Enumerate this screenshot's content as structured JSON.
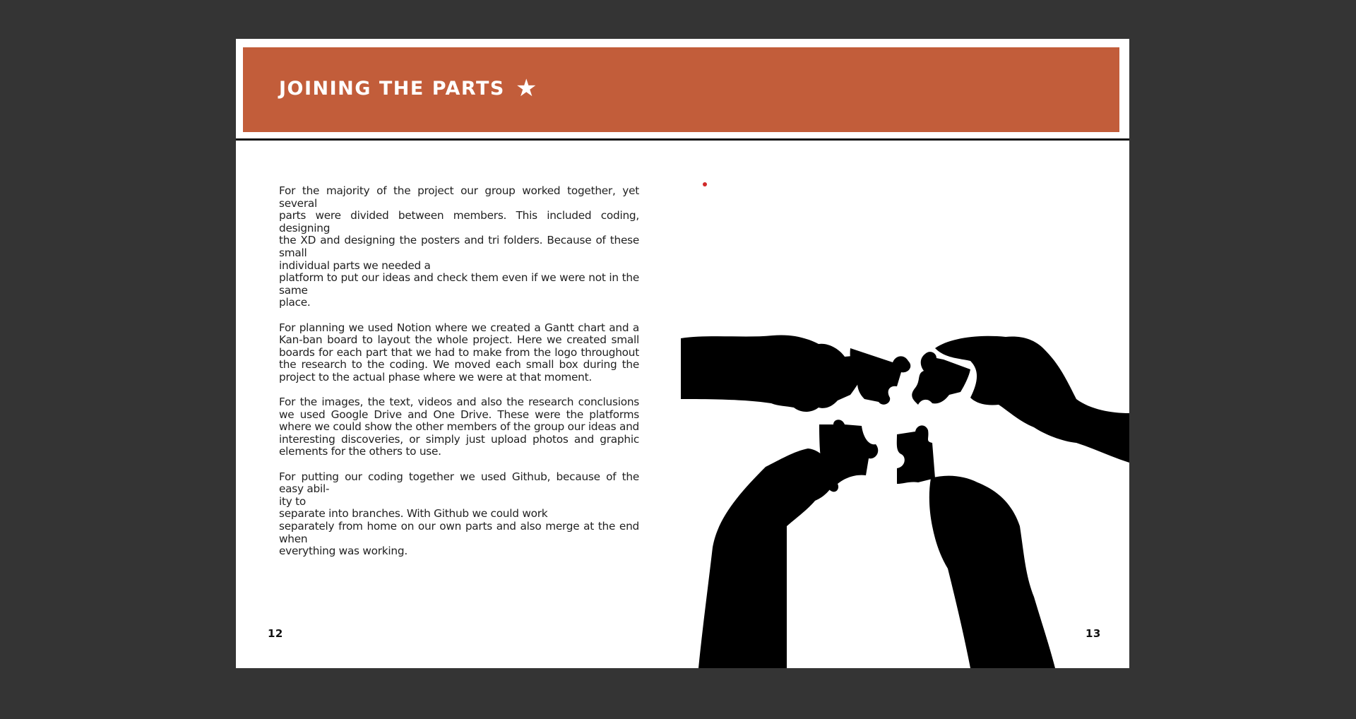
{
  "header": {
    "title": "JOINING THE PARTS",
    "star_icon": "star-icon"
  },
  "body": {
    "paragraph1_lines": [
      "For the majority of the project our group worked together, yet several",
      "parts were divided between members.  This included coding, designing",
      "the XD and designing the posters and tri folders. Because of these small",
      "individual parts we needed a",
      "platform to put our ideas and check them even if we were not in the same",
      "place."
    ],
    "paragraph2": "For planning we used Notion where we created a Gantt chart and a Kan-ban board to layout the whole project. Here we created small boards for each part that we had to make from the logo throughout the research to the coding. We moved each small box during the project to the actual phase where we were at that moment.",
    "paragraph3": "For the images, the text, videos and also the research conclusions we used Google Drive and One Drive. These were the platforms where we could show the other members of the group our ideas and interesting discoveries, or simply just upload photos and graphic elements for the others to use.",
    "paragraph4_lines": [
      "For putting our coding together we used Github, because of the easy abil-",
      "ity to",
      "separate into branches. With Github we could work",
      "separately from home on our own parts and also merge at the end when",
      "everything was working."
    ]
  },
  "pages": {
    "left": "12",
    "right": "13"
  },
  "colors": {
    "background": "#343434",
    "header_band": "#c25d3a",
    "page": "#ffffff",
    "text": "#222222",
    "silhouette": "#000000"
  },
  "illustration": {
    "icon": "puzzle-hands-illustration"
  }
}
